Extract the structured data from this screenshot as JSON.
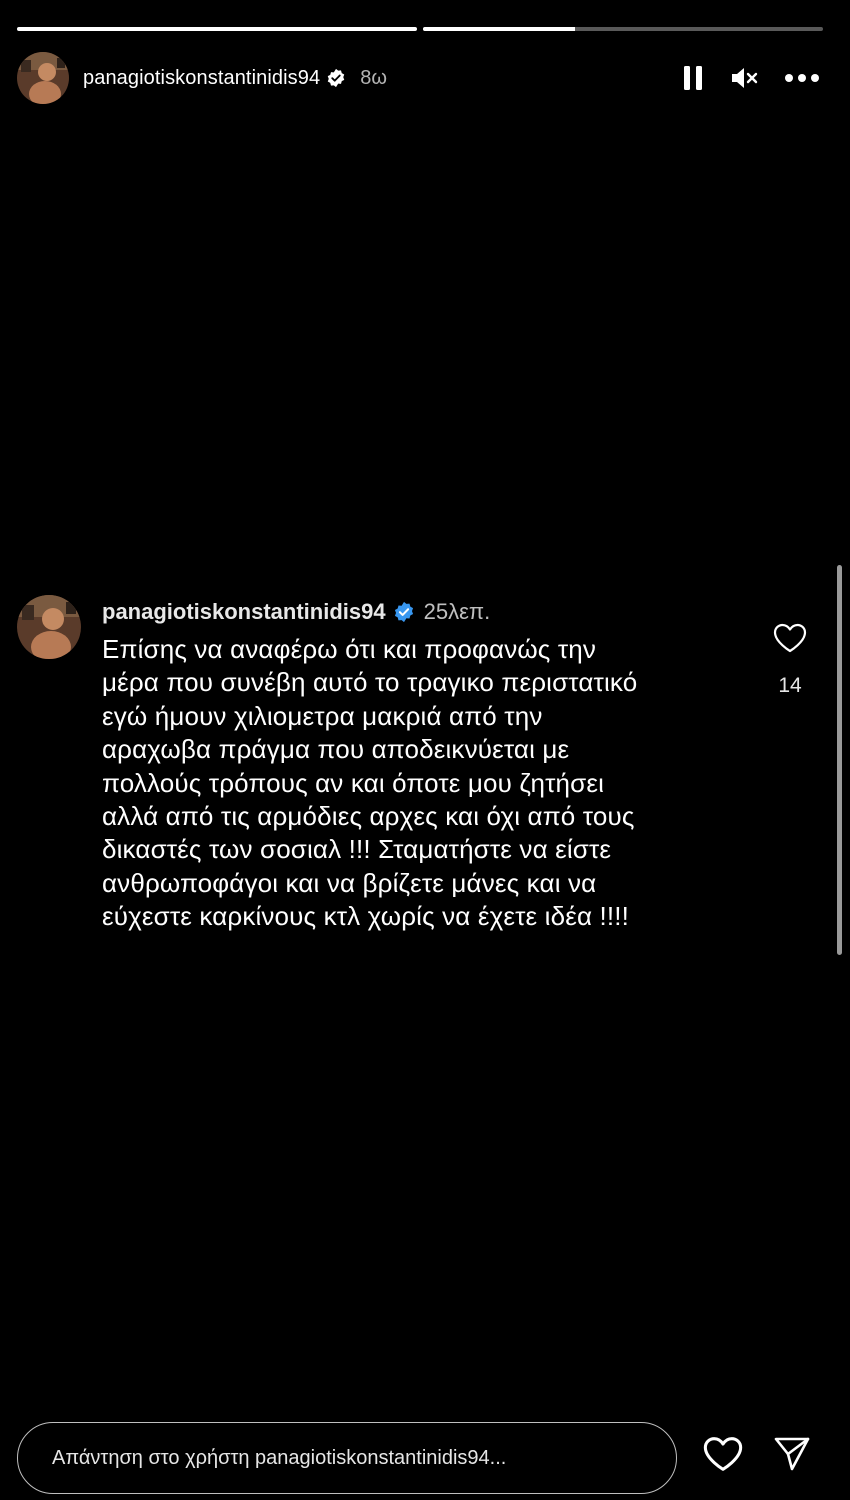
{
  "story": {
    "progress": [
      1.0,
      0.38
    ],
    "username": "panagiotiskonstantinidis94",
    "time": "8ω",
    "controls": {
      "pause_icon": "pause-icon",
      "mute_icon": "speaker-muted-icon",
      "more_icon": "more-horizontal-icon"
    }
  },
  "comment": {
    "username": "panagiotiskonstantinidis94",
    "time": "25λεπ.",
    "text": "Επίσης να αναφέρω ότι και προφανώς την\nμέρα που συνέβη αυτό το τραγικο περιστατικό\nεγώ ήμουν χιλιομετρα μακριά από την\nαραχωβα πράγμα που αποδεικνύεται με\nπολλούς τρόπους αν και όποτε μου ζητήσει\nαλλά από τις αρμόδιες αρχες και όχι από τους\nδικαστές των σοσιαλ !!! Σταματήστε να είστε\nανθρωποφάγοι και να βρίζετε μάνες και να\nεύχεστε καρκίνους κτλ χωρίς να έχετε ιδέα !!!!",
    "likes": "14"
  },
  "reply": {
    "placeholder": "Απάντηση στο χρήστη panagiotiskonstantinidis94..."
  },
  "colors": {
    "background": "#000000",
    "verified": "#3897f0",
    "text": "#ffffff"
  }
}
